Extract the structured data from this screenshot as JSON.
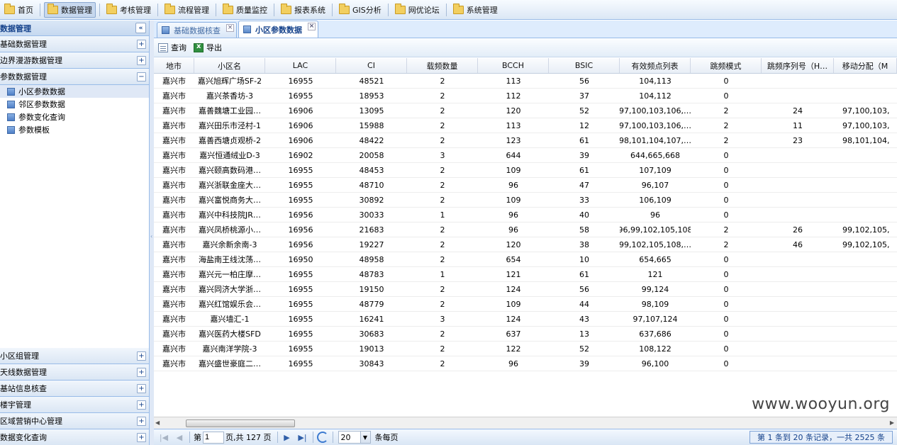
{
  "topnav": {
    "items": [
      {
        "label": "首页",
        "active": false
      },
      {
        "label": "数据管理",
        "active": true
      },
      {
        "label": "考核管理",
        "active": false
      },
      {
        "label": "流程管理",
        "active": false
      },
      {
        "label": "质量监控",
        "active": false
      },
      {
        "label": "报表系统",
        "active": false
      },
      {
        "label": "GIS分析",
        "active": false
      },
      {
        "label": "网优论坛",
        "active": false
      },
      {
        "label": "系统管理",
        "active": false
      }
    ]
  },
  "sidebar": {
    "title": "数据管理",
    "collapse_glyph": "«",
    "sections_top": [
      {
        "label": "基础数据管理",
        "glyph": "+"
      },
      {
        "label": "边界漫游数据管理",
        "glyph": "+"
      },
      {
        "label": "参数数据管理",
        "glyph": "−"
      }
    ],
    "tree": [
      {
        "label": "小区参数数据",
        "selected": true
      },
      {
        "label": "邻区参数数据",
        "selected": false
      },
      {
        "label": "参数变化查询",
        "selected": false
      },
      {
        "label": "参数模板",
        "selected": false
      }
    ],
    "sections_bottom": [
      {
        "label": "小区组管理",
        "glyph": "+"
      },
      {
        "label": "天线数据管理",
        "glyph": "+"
      },
      {
        "label": "基站信息核查",
        "glyph": "+"
      },
      {
        "label": "楼宇管理",
        "glyph": "+"
      },
      {
        "label": "区域营销中心管理",
        "glyph": "+"
      },
      {
        "label": "数据变化查询",
        "glyph": "+"
      }
    ]
  },
  "tabs": [
    {
      "label": "基础数据核查",
      "active": false
    },
    {
      "label": "小区参数数据",
      "active": true
    }
  ],
  "toolbar": {
    "query_label": "查询",
    "export_label": "导出"
  },
  "grid": {
    "columns": [
      "地市",
      "小区名",
      "LAC",
      "CI",
      "载频数量",
      "BCCH",
      "BSIC",
      "有效频点列表",
      "跳频模式",
      "跳频序列号（H…",
      "移动分配（M"
    ],
    "rows": [
      [
        "嘉兴市",
        "嘉兴旭辉广场SF-2",
        "16955",
        "48521",
        "2",
        "113",
        "56",
        "104,113",
        "0",
        "",
        ""
      ],
      [
        "嘉兴市",
        "嘉兴茶香坊-3",
        "16955",
        "18953",
        "2",
        "112",
        "37",
        "104,112",
        "0",
        "",
        ""
      ],
      [
        "嘉兴市",
        "嘉善魏塘工业园…",
        "16906",
        "13095",
        "2",
        "120",
        "52",
        "97,100,103,106,…",
        "2",
        "24",
        "97,100,103,"
      ],
      [
        "嘉兴市",
        "嘉兴田乐市泾村-1",
        "16906",
        "15988",
        "2",
        "113",
        "12",
        "97,100,103,106,…",
        "2",
        "11",
        "97,100,103,"
      ],
      [
        "嘉兴市",
        "嘉善西塘贞观桥-2",
        "16906",
        "48422",
        "2",
        "123",
        "61",
        "98,101,104,107,…",
        "2",
        "23",
        "98,101,104,"
      ],
      [
        "嘉兴市",
        "嘉兴恒通绒业D-3",
        "16902",
        "20058",
        "3",
        "644",
        "39",
        "644,665,668",
        "0",
        "",
        ""
      ],
      [
        "嘉兴市",
        "嘉兴颐高数码港…",
        "16955",
        "48453",
        "2",
        "109",
        "61",
        "107,109",
        "0",
        "",
        ""
      ],
      [
        "嘉兴市",
        "嘉兴浙联金座大…",
        "16955",
        "48710",
        "2",
        "96",
        "47",
        "96,107",
        "0",
        "",
        ""
      ],
      [
        "嘉兴市",
        "嘉兴富悦商务大…",
        "16955",
        "30892",
        "2",
        "109",
        "33",
        "106,109",
        "0",
        "",
        ""
      ],
      [
        "嘉兴市",
        "嘉兴中科技院JR…",
        "16956",
        "30033",
        "1",
        "96",
        "40",
        "96",
        "0",
        "",
        ""
      ],
      [
        "嘉兴市",
        "嘉兴凤桥桃源小…",
        "16956",
        "21683",
        "2",
        "96",
        "58",
        "96,99,102,105,108",
        "2",
        "26",
        "99,102,105,"
      ],
      [
        "嘉兴市",
        "嘉兴余新余南-3",
        "16956",
        "19227",
        "2",
        "120",
        "38",
        "99,102,105,108,…",
        "2",
        "46",
        "99,102,105,"
      ],
      [
        "嘉兴市",
        "海盐南王线沈荡…",
        "16950",
        "48958",
        "2",
        "654",
        "10",
        "654,665",
        "0",
        "",
        ""
      ],
      [
        "嘉兴市",
        "嘉兴元一柏庄摩…",
        "16955",
        "48783",
        "1",
        "121",
        "61",
        "121",
        "0",
        "",
        ""
      ],
      [
        "嘉兴市",
        "嘉兴同济大学浙…",
        "16955",
        "19150",
        "2",
        "124",
        "56",
        "99,124",
        "0",
        "",
        ""
      ],
      [
        "嘉兴市",
        "嘉兴红馆娱乐会…",
        "16955",
        "48779",
        "2",
        "109",
        "44",
        "98,109",
        "0",
        "",
        ""
      ],
      [
        "嘉兴市",
        "嘉兴墙汇-1",
        "16955",
        "16241",
        "3",
        "124",
        "43",
        "97,107,124",
        "0",
        "",
        ""
      ],
      [
        "嘉兴市",
        "嘉兴医药大楼SFD",
        "16955",
        "30683",
        "2",
        "637",
        "13",
        "637,686",
        "0",
        "",
        ""
      ],
      [
        "嘉兴市",
        "嘉兴南洋学院-3",
        "16955",
        "19013",
        "2",
        "122",
        "52",
        "108,122",
        "0",
        "",
        ""
      ],
      [
        "嘉兴市",
        "嘉兴盛世豪庭二…",
        "16955",
        "30843",
        "2",
        "96",
        "39",
        "96,100",
        "0",
        "",
        ""
      ]
    ]
  },
  "pager": {
    "page_prefix": "第",
    "page_value": "1",
    "page_suffix": "页,共 127 页",
    "page_size": "20",
    "per_page_label": "条每页",
    "info": "第 1 条到 20 条记录，一共 2525 条"
  },
  "watermark": "www.wooyun.org"
}
